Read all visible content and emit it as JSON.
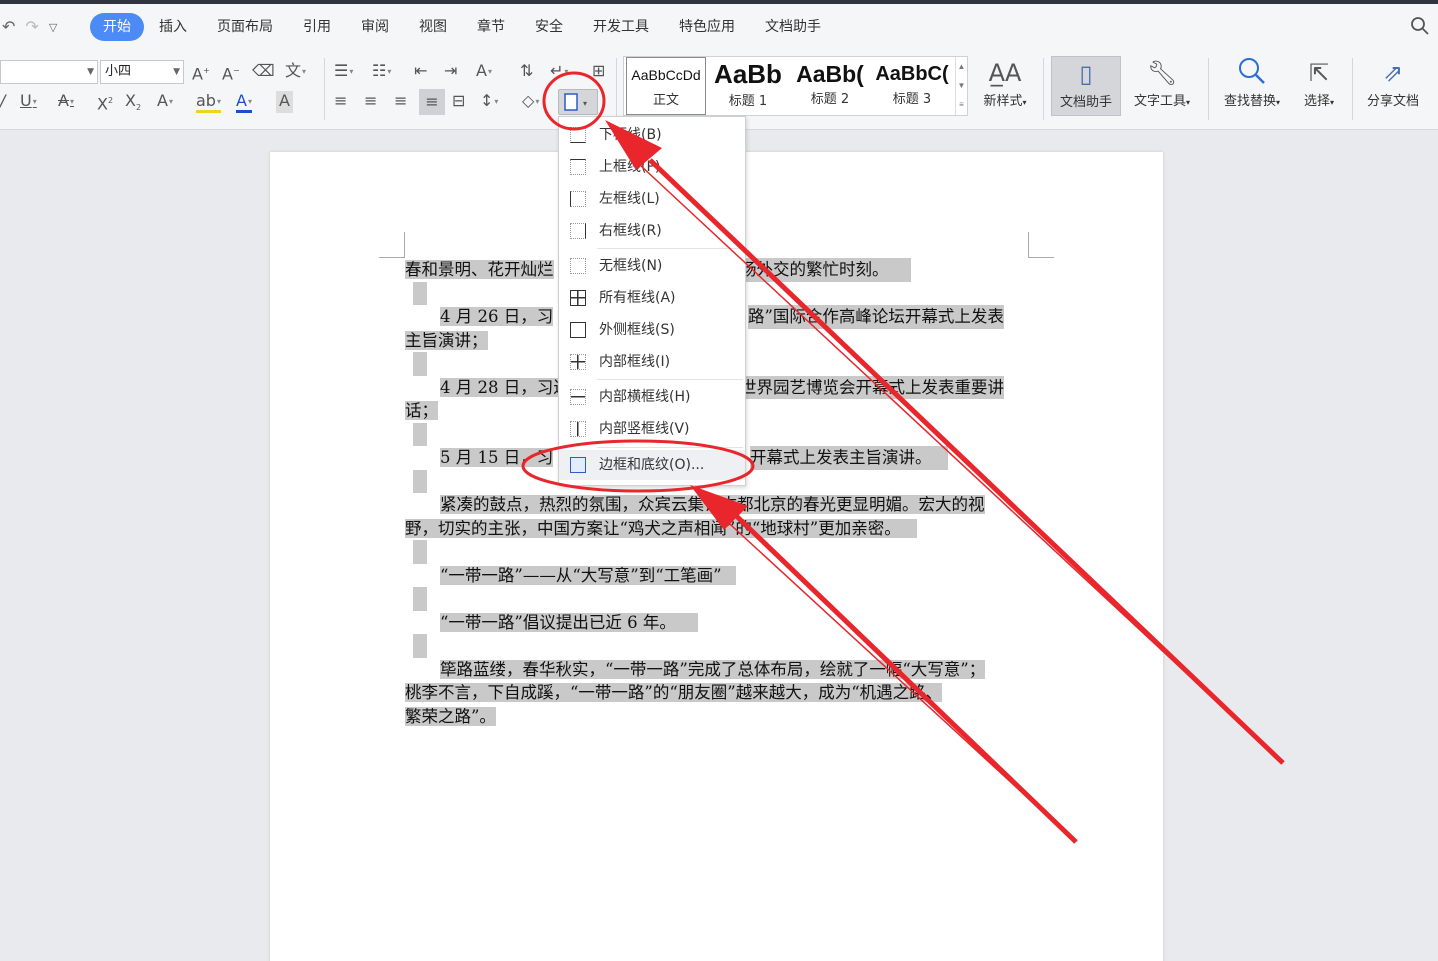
{
  "colors": {
    "accent": "#4c8af5",
    "annotation_red": "#e8262b",
    "selection_highlight": "#c9c9c9"
  },
  "quick_access": {
    "undo_icon": "undo-icon",
    "redo_icon": "redo-icon",
    "customize_icon": "chevron-down-icon"
  },
  "tabs": [
    {
      "label": "开始",
      "active": true
    },
    {
      "label": "插入"
    },
    {
      "label": "页面布局"
    },
    {
      "label": "引用"
    },
    {
      "label": "审阅"
    },
    {
      "label": "视图"
    },
    {
      "label": "章节"
    },
    {
      "label": "安全"
    },
    {
      "label": "开发工具"
    },
    {
      "label": "特色应用"
    },
    {
      "label": "文档助手"
    }
  ],
  "ribbon": {
    "font_name_value": "",
    "font_size_value": "小四",
    "styles": [
      {
        "sample": "AaBbCcDd",
        "name": "正文"
      },
      {
        "sample": "AaBb",
        "name": "标题 1"
      },
      {
        "sample": "AaBb(",
        "name": "标题 2"
      },
      {
        "sample": "AaBbC(",
        "name": "标题 3"
      }
    ],
    "new_style_label": "新样式",
    "doc_assistant_label": "文档助手",
    "text_tools_label": "文字工具",
    "find_replace_label": "查找替换",
    "select_label": "选择",
    "share_doc_label": "分享文档"
  },
  "border_menu": {
    "items": [
      {
        "label": "下框线(B)",
        "icon": "bottom-border-icon"
      },
      {
        "label": "上框线(P)",
        "icon": "top-border-icon"
      },
      {
        "label": "左框线(L)",
        "icon": "left-border-icon"
      },
      {
        "label": "右框线(R)",
        "icon": "right-border-icon"
      },
      {
        "label": "无框线(N)",
        "icon": "no-border-icon"
      },
      {
        "label": "所有框线(A)",
        "icon": "all-borders-icon"
      },
      {
        "label": "外侧框线(S)",
        "icon": "outside-borders-icon"
      },
      {
        "label": "内部框线(I)",
        "icon": "inside-borders-icon"
      },
      {
        "label": "内部横框线(H)",
        "icon": "inside-horizontal-border-icon"
      },
      {
        "label": "内部竖框线(V)",
        "icon": "inside-vertical-border-icon"
      },
      {
        "label": "边框和底纹(O)...",
        "icon": "borders-and-shading-icon"
      }
    ]
  },
  "document": {
    "lines": [
      {
        "left": "春和景明、花开灿烂",
        "right": "场外交的繁忙时刻。"
      },
      {
        "left": "4 月 26 日，习",
        "right": "路”国际合作高峰论坛开幕式上发表"
      },
      {
        "left": "主旨演讲；"
      },
      {
        "left": "4 月 28 日，习近",
        "right": "世界园艺博览会开幕式上发表重要讲"
      },
      {
        "left": "话；"
      },
      {
        "left": "5 月 15 日，习",
        "right": "开幕式上发表主旨演讲。"
      },
      {
        "left": "紧凑的鼓点，热烈的氛围，众宾云集让古都北京的春光更显明媚。宏大的视"
      },
      {
        "left": "野，切实的主张，中国方案让“鸡犬之声相闻”的“地球村”更加亲密。"
      },
      {
        "left": "“一带一路”——从“大写意”到“工笔画”"
      },
      {
        "left": "“一带一路”倡议提出已近 6 年。"
      },
      {
        "left": "筚路蓝缕，春华秋实，“一带一路”完成了总体布局，绘就了一幅“大写意”；"
      },
      {
        "left": "桃李不言，下自成蹊，“一带一路”的“朋友圈”越来越大，成为“机遇之路、"
      },
      {
        "left": "繁荣之路”。"
      }
    ]
  }
}
